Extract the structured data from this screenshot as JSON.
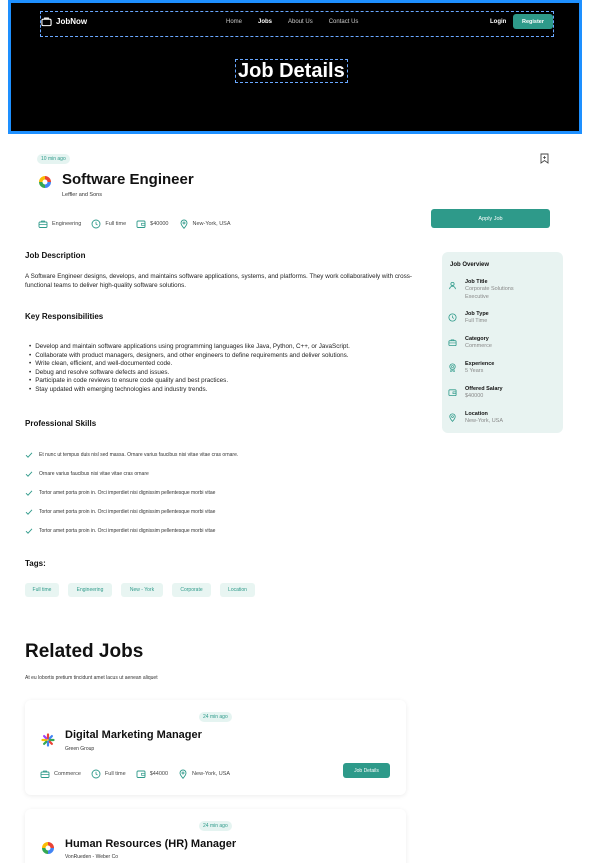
{
  "header": {
    "brand": "JobNow",
    "nav": [
      "Home",
      "Jobs",
      "About Us",
      "Contact Us"
    ],
    "login": "Login",
    "register": "Register",
    "hero_title": "Job Details"
  },
  "job": {
    "posted": "10 min ago",
    "title": "Software Engineer",
    "company": "Leffler and Sons",
    "category": "Engineering",
    "type": "Full time",
    "salary": "$40000",
    "location": "New-York, USA",
    "apply": "Apply Job"
  },
  "description": {
    "heading": "Job Description",
    "text": "A Software Engineer designs, develops, and maintains software applications, systems, and platforms. They work collaboratively with cross-functional teams to deliver high-quality software solutions."
  },
  "responsibilities": {
    "heading": "Key Responsibilities",
    "items": [
      "Develop and maintain software applications using programming languages like Java, Python, C++, or JavaScript.",
      "Collaborate with product managers, designers, and other engineers to define requirements and deliver solutions.",
      "Write clean, efficient, and well-documented code.",
      "Debug and resolve software defects and issues.",
      "Participate in code reviews to ensure code quality and best practices.",
      "Stay updated with emerging technologies and industry trends."
    ]
  },
  "skills": {
    "heading": "Professional Skills",
    "items": [
      "Et nunc ut tempus duis nisl sed massa. Ornare varius faucibus nisi vitae vitae cras ornare.",
      "Ornare varius faucibus nisi vitae vitae cras ornare",
      "Tortor amet porta proin in. Orci imperdiet nisi dignissim pellentesque morbi vitae",
      "Tortor amet porta proin in. Orci imperdiet nisi dignissim pellentesque morbi vitae",
      "Tortor amet porta proin in. Orci imperdiet nisi dignissim pellentesque morbi vitae"
    ]
  },
  "tags": {
    "heading": "Tags:",
    "items": [
      "Full time",
      "Engineering",
      "New - York",
      "Corporate",
      "Location"
    ]
  },
  "overview": {
    "title": "Job Overview",
    "items": [
      {
        "label": "Job Title",
        "value": "Corporate Solutions Executive",
        "icon": "user-icon"
      },
      {
        "label": "Job Type",
        "value": "Full Time",
        "icon": "clock-icon"
      },
      {
        "label": "Category",
        "value": "Commerce",
        "icon": "briefcase-icon"
      },
      {
        "label": "Experience",
        "value": "5 Years",
        "icon": "award-icon"
      },
      {
        "label": "Offered Salary",
        "value": "$40000",
        "icon": "wallet-icon"
      },
      {
        "label": "Location",
        "value": "New-York, USA",
        "icon": "location-icon"
      }
    ]
  },
  "related": {
    "heading": "Related Jobs",
    "subtitle": "At eu lobortis pretium tincidunt amet lacus ut aenean aliquet",
    "cards": [
      {
        "posted": "24 min ago",
        "title": "Digital Marketing Manager",
        "company": "Green Group",
        "category": "Commerce",
        "type": "Full time",
        "salary": "$44000",
        "location": "New-York, USA",
        "button": "Job Details"
      },
      {
        "posted": "24 min ago",
        "title": "Human Resources (HR) Manager",
        "company": "VonRueden - Weber Co"
      }
    ]
  },
  "colors": {
    "accent": "#2e9a8a",
    "hero_bg": "#000000",
    "panel_bg": "#e8f3f1"
  }
}
